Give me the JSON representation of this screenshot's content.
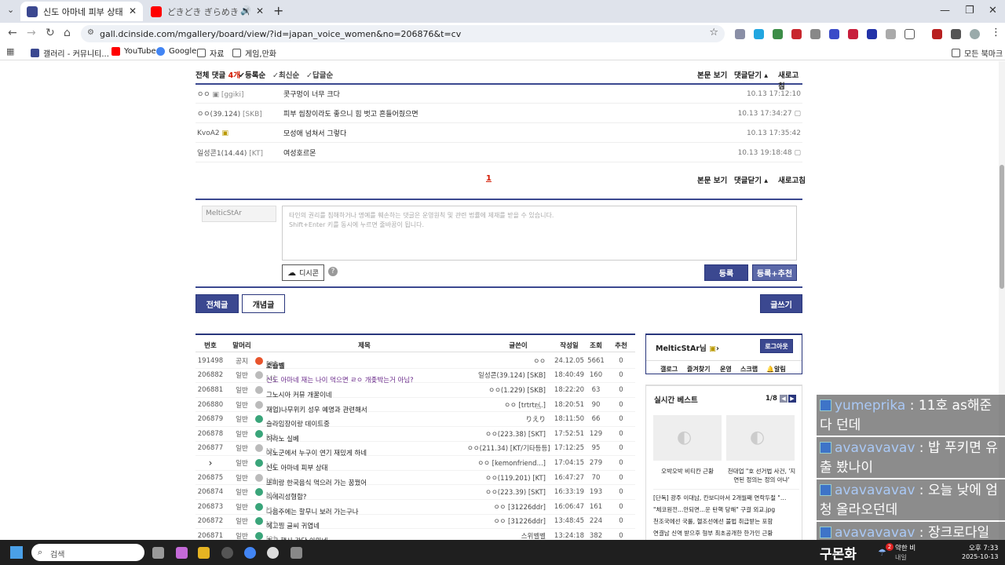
{
  "browser": {
    "tabs": [
      {
        "title": "신도 아마네 피부 상태 - 일본",
        "active": true,
        "color": "#3b4890"
      },
      {
        "title": "どきどき ぎらめき パズリ",
        "active": false,
        "color": "#ff0000"
      }
    ],
    "new_tab": "+",
    "url": "gall.dcinside.com/mgallery/board/view/?id=japan_voice_women&no=206876&t=cv",
    "bookmarks": [
      {
        "label": "갤러리 - 커뮤니티...",
        "color": "#3b4890"
      },
      {
        "label": "YouTube",
        "color": "#ff0000"
      },
      {
        "label": "Google",
        "color": "#4285f4"
      },
      {
        "label": "자료",
        "color": "#555"
      },
      {
        "label": "게임,만화",
        "color": "#555"
      }
    ],
    "all_bookmarks": "모든 북마크"
  },
  "comments": {
    "header_total_label": "전체 댓글",
    "header_total_count": "4개",
    "sort_options": [
      "등록순",
      "최신순",
      "답글순"
    ],
    "actions": [
      "본문 보기",
      "댓글닫기",
      "새로고침"
    ],
    "items": [
      {
        "author": "ㅇㅇ",
        "ip": "[ggiki]",
        "text": "콧구멍이 너무 크다",
        "date": "10.13 17:12:10"
      },
      {
        "author": "ㅇㅇ(39.124)",
        "ip": "[SKB]",
        "text": "피부 씹창이라도 좋으니 힘 벗고 흔들어줬으면",
        "date": "10.13 17:34:27"
      },
      {
        "author": "KvoA2",
        "ip": "",
        "text": "모성애 넘쳐서 그렇다",
        "date": "10.13 17:35:42"
      },
      {
        "author": "일성콘1(14.44)",
        "ip": "[KT]",
        "text": "여성호르몬",
        "date": "10.13 19:18:48"
      }
    ],
    "page": "1",
    "write": {
      "name": "MelticStAr",
      "placeholder_line1": "타인의 권리를 침해하거나 명예를 훼손하는 댓글은 운영원칙 및 관련 법률에 제재를 받을 수 있습니다.",
      "placeholder_line2": "Shift+Enter 키를 동시에 누르면 줄바꿈이 됩니다.",
      "dccon": "디시콘",
      "submit": "등록",
      "submit_recommend": "등록+추천"
    }
  },
  "board": {
    "tab_all": "전체글",
    "tab_concept": "개념글",
    "write": "글쓰기",
    "columns": [
      "번호",
      "말머리",
      "제목",
      "글쓴이",
      "작성일",
      "조회",
      "추천"
    ],
    "rows": [
      {
        "no": "191498",
        "head": "공지",
        "title": "호출벨",
        "cnt": "[2]",
        "writer": "ㅇㅇ",
        "date": "24.12.05",
        "views": "5661",
        "rec": "0",
        "icon": "#e8542c",
        "bold": true
      },
      {
        "no": "206882",
        "head": "일반",
        "title": "신도 아마네 재는 나이 먹으면 ㄹㅇ 개좆박는거 아님?",
        "cnt": "[4]",
        "writer": "일성콘(39.124) [SKB]",
        "date": "18:40:49",
        "views": "160",
        "rec": "0",
        "icon": "#bbb",
        "visited": true
      },
      {
        "no": "206881",
        "head": "일반",
        "title": "그노시아 커뮤 개꿀이네",
        "cnt": "",
        "writer": "ㅇㅇ(1.229) [SKB]",
        "date": "18:22:20",
        "views": "63",
        "rec": "0",
        "icon": "#bbb"
      },
      {
        "no": "206880",
        "head": "일반",
        "title": "재업)나무위키 성우 예명과 관련해서",
        "cnt": "",
        "writer": "ㅇㅇ [trtrtr...]",
        "date": "18:20:51",
        "views": "90",
        "rec": "0",
        "icon": "#bbb"
      },
      {
        "no": "206879",
        "head": "일반",
        "title": "슬라임장이랑 데이트중",
        "cnt": "",
        "writer": "りえり",
        "date": "18:11:50",
        "views": "66",
        "rec": "0",
        "icon": "#3aa57a"
      },
      {
        "no": "206878",
        "head": "일반",
        "title": "히라노 실베",
        "cnt": "[3]",
        "writer": "ㅇㅇ(223.38) [SKT]",
        "date": "17:52:51",
        "views": "129",
        "rec": "0",
        "icon": "#3aa57a"
      },
      {
        "no": "206877",
        "head": "일반",
        "title": "야노군에서 누구이 연기 재밌게 하네",
        "cnt": "[2]",
        "writer": "ㅇㅇ(211.34) [KT/기타등등]",
        "date": "17:12:25",
        "views": "95",
        "rec": "0",
        "icon": "#bbb"
      },
      {
        "no": "›",
        "head": "일반",
        "title": "신도 아마네 피부 상태",
        "cnt": "[4]",
        "writer": "ㅇㅇ [kemonfriend...]",
        "date": "17:04:15",
        "views": "279",
        "rec": "0",
        "icon": "#3aa57a",
        "current": true
      },
      {
        "no": "206875",
        "head": "일반",
        "title": "또미랑 한국음식 먹으러 가는 꿈꿨어",
        "cnt": "[2]",
        "writer": "ㅇㅇ(119.201) [KT]",
        "date": "16:47:27",
        "views": "70",
        "rec": "0",
        "icon": "#bbb"
      },
      {
        "no": "206874",
        "head": "일반",
        "title": "리에리성형함?",
        "cnt": "[1]",
        "writer": "ㅇㅇ(223.39) [SKT]",
        "date": "16:33:19",
        "views": "193",
        "rec": "0",
        "icon": "#3aa57a"
      },
      {
        "no": "206873",
        "head": "일반",
        "title": "다음주에는 할무니 보러 가는구나",
        "cnt": "[1]",
        "writer": "ㅇㅇ [31226ddr]",
        "date": "16:06:47",
        "views": "161",
        "rec": "0",
        "icon": "#3aa57a"
      },
      {
        "no": "206872",
        "head": "일반",
        "title": "헤고찡 글씨 귀엽네",
        "cnt": "[2]",
        "writer": "ㅇㅇ [31226ddr]",
        "date": "13:48:45",
        "views": "224",
        "rec": "0",
        "icon": "#3aa57a"
      },
      {
        "no": "206871",
        "head": "일반",
        "title": "추구 행사 각단 아마네",
        "cnt": "[2]",
        "writer": "스위벨벨",
        "date": "13:24:18",
        "views": "382",
        "rec": "0",
        "icon": "#3aa57a"
      }
    ]
  },
  "sidebar": {
    "user": "MelticStAr님",
    "logout": "로그아웃",
    "menu": [
      "갤로그",
      "즐겨찾기",
      "운영",
      "스크랩",
      "알림"
    ],
    "best_title": "실시간 베스트",
    "best_page": "1/8",
    "thumbs": [
      {
        "caption": "오박오박 비티칸 근황"
      },
      {
        "caption": "천대업 \"호 선거법 사건, '지연된 정의는 정의 아냐'"
      }
    ],
    "news": [
      "[단독] 광주 이대남, 칸보디아서 2개월째 연락두절 \"…",
      "\"체코원전...안되면...운 탄핵 당해\" 구걸 외교.jpg",
      "천조국에선 국룰, 헬조선에선 불법 취급받는 포함",
      "연결남 신역 받으후 형부 최초공개한 한가인 근황"
    ]
  },
  "chat": [
    {
      "name": "yumeprika",
      "msg": "11호 as해준다 던데"
    },
    {
      "name": "avavavavav",
      "msg": "밥 푸키면 유출 봤나이"
    },
    {
      "name": "avavavavav",
      "msg": "오늘 낮에 엄청 올라오던데"
    },
    {
      "name": "avavavavav",
      "msg": "장크로다일 아"
    }
  ],
  "taskbar": {
    "search": "검색",
    "overlay_text": "구몬화",
    "weather_count": "2",
    "weather": "약한 비",
    "weather_sub": "내일",
    "time": "오후 7:33",
    "date": "2025-10-13"
  }
}
